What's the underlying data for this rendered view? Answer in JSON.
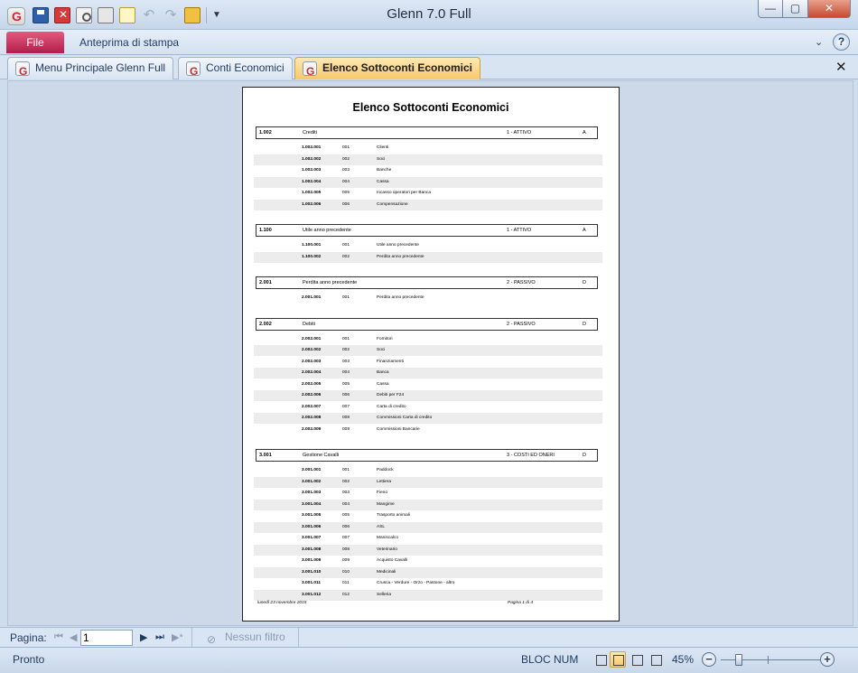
{
  "window": {
    "title": "Glenn 7.0 Full",
    "minimize": "—",
    "maximize": "▢",
    "close": "✕"
  },
  "ribbon": {
    "file_label": "File",
    "tab_label": "Anteprima di stampa",
    "chevron": "⌄",
    "help": "?"
  },
  "doc_tabs": [
    {
      "label": "Menu Principale Glenn Full"
    },
    {
      "label": "Conti Economici"
    },
    {
      "label": "Elenco Sottoconti Economici"
    }
  ],
  "doc_tabs_close": "✕",
  "report": {
    "title": "Elenco Sottoconti Economici",
    "groups": [
      {
        "code": "1.002",
        "desc": "Crediti",
        "category": "1 - ATTIVO",
        "type": "A",
        "rows": [
          {
            "full": "1.002.001",
            "sub": "001",
            "desc": "Clienti"
          },
          {
            "full": "1.002.002",
            "sub": "002",
            "desc": "Soci"
          },
          {
            "full": "1.002.003",
            "sub": "003",
            "desc": "Banche"
          },
          {
            "full": "1.002.004",
            "sub": "004",
            "desc": "Cassa"
          },
          {
            "full": "1.002.005",
            "sub": "005",
            "desc": "Incasso operatori per Banca"
          },
          {
            "full": "1.002.006",
            "sub": "006",
            "desc": "Compensazione"
          }
        ]
      },
      {
        "code": "1.100",
        "desc": "Utile anno precedente",
        "category": "1 - ATTIVO",
        "type": "A",
        "rows": [
          {
            "full": "1.100.001",
            "sub": "001",
            "desc": "Utile anno precedente"
          },
          {
            "full": "1.100.002",
            "sub": "002",
            "desc": "Perdita anno precedente"
          }
        ]
      },
      {
        "code": "2.001",
        "desc": "Perdita anno precedente",
        "category": "2 - PASSIVO",
        "type": "D",
        "rows": [
          {
            "full": "2.001.001",
            "sub": "001",
            "desc": "Perdita anno precedente"
          }
        ]
      },
      {
        "code": "2.002",
        "desc": "Debiti",
        "category": "2 - PASSIVO",
        "type": "D",
        "rows": [
          {
            "full": "2.002.001",
            "sub": "001",
            "desc": "Fornitori"
          },
          {
            "full": "2.002.002",
            "sub": "002",
            "desc": "Soci"
          },
          {
            "full": "2.002.003",
            "sub": "003",
            "desc": "Finanziamenti"
          },
          {
            "full": "2.002.004",
            "sub": "004",
            "desc": "Banca"
          },
          {
            "full": "2.002.005",
            "sub": "005",
            "desc": "Cassa"
          },
          {
            "full": "2.002.006",
            "sub": "006",
            "desc": "Debiti per F24"
          },
          {
            "full": "2.002.007",
            "sub": "007",
            "desc": "Carta di credito"
          },
          {
            "full": "2.002.008",
            "sub": "008",
            "desc": "Commissioni Carta di credito"
          },
          {
            "full": "2.002.009",
            "sub": "009",
            "desc": "Commissioni Bancarie"
          }
        ]
      },
      {
        "code": "3.001",
        "desc": "Gestione Cavalli",
        "category": "3 - COSTI ED ONERI",
        "type": "D",
        "rows": [
          {
            "full": "3.001.001",
            "sub": "001",
            "desc": "Paddock"
          },
          {
            "full": "3.001.002",
            "sub": "002",
            "desc": "Lettiera"
          },
          {
            "full": "3.001.003",
            "sub": "003",
            "desc": "Fieno"
          },
          {
            "full": "3.001.004",
            "sub": "004",
            "desc": "Mangime"
          },
          {
            "full": "3.001.005",
            "sub": "005",
            "desc": "Trasporto animali"
          },
          {
            "full": "3.001.006",
            "sub": "006",
            "desc": "ASL"
          },
          {
            "full": "3.001.007",
            "sub": "007",
            "desc": "Maniscalco"
          },
          {
            "full": "3.001.008",
            "sub": "008",
            "desc": "Veterinario"
          },
          {
            "full": "3.001.009",
            "sub": "009",
            "desc": "Acquisto Cavalli"
          },
          {
            "full": "3.001.010",
            "sub": "010",
            "desc": "Medicinali"
          },
          {
            "full": "3.001.011",
            "sub": "011",
            "desc": "Crusca - Verdure - Orzo - Pastone - altro"
          },
          {
            "full": "3.001.012",
            "sub": "012",
            "desc": "Selleria"
          }
        ]
      }
    ],
    "footer_date": "lunedì 23 novembre 2015",
    "footer_page": "Pagina 1 di 4"
  },
  "navbar": {
    "label": "Pagina:",
    "first": "⏮",
    "prev": "◀",
    "page_value": "1",
    "next": "▶",
    "last": "⏭",
    "new": "▶*",
    "filter_label": "Nessun filtro",
    "filter_icon": "⊘"
  },
  "statusbar": {
    "status": "Pronto",
    "bloc_num": "BLOC NUM",
    "zoom": "45%",
    "zoom_level_percent": 45,
    "zoom_minus": "−",
    "zoom_plus": "+"
  }
}
